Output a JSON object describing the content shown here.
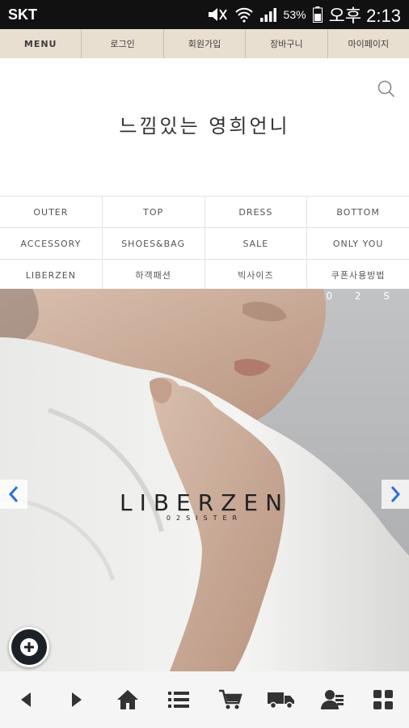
{
  "status_bar": {
    "carrier": "SKT",
    "battery": "53%",
    "time": "오후 2:13"
  },
  "top_nav": {
    "items": [
      "MENU",
      "로그인",
      "회원가입",
      "장바구니",
      "마이페이지"
    ]
  },
  "header": {
    "title": "느낌있는 영희언니"
  },
  "categories": {
    "rows": [
      [
        "OUTER",
        "TOP",
        "DRESS",
        "BOTTOM"
      ],
      [
        "ACCESSORY",
        "SHOES&BAG",
        "SALE",
        "ONLY YOU"
      ],
      [
        "LIBERZEN",
        "하객패션",
        "빅사이즈",
        "쿠폰사용방법"
      ]
    ]
  },
  "banner": {
    "counter": "0 2 S",
    "logo_text": "LIBERZEN",
    "logo_sub": "02SISTER"
  },
  "bottom_bar": {
    "icons": [
      "back-icon",
      "forward-icon",
      "home-icon",
      "list-icon",
      "cart-icon",
      "delivery-truck-icon",
      "user-icon",
      "grid-icon"
    ]
  }
}
